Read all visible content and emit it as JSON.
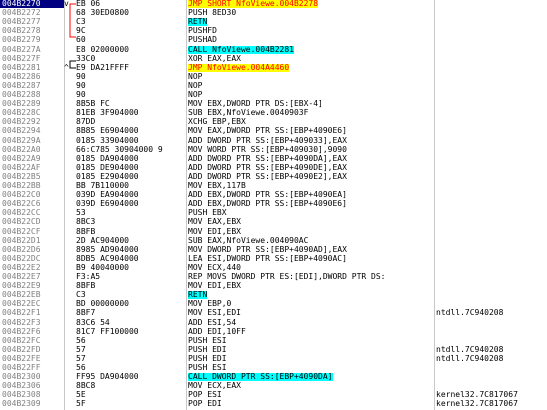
{
  "window_title": "",
  "rows": [
    {
      "addr": "004B2270",
      "marker": "v",
      "hex": "EB 06",
      "dis": "JMP SHORT NfoViewe.004B2278",
      "com": "",
      "hl": "jmp",
      "sel": true
    },
    {
      "addr": "004B2272",
      "marker": "",
      "hex": "68 30ED0800",
      "dis": "PUSH 8ED30",
      "com": "",
      "hl": "",
      "sel": false
    },
    {
      "addr": "004B2277",
      "marker": "",
      "hex": "C3",
      "dis": "RETN",
      "com": "",
      "hl": "call",
      "sel": false
    },
    {
      "addr": "004B2278",
      "marker": "",
      "hex": "9C",
      "dis": "PUSHFD",
      "com": "",
      "hl": "",
      "sel": false
    },
    {
      "addr": "004B2279",
      "marker": "",
      "hex": "60",
      "dis": "PUSHAD",
      "com": "",
      "hl": "",
      "sel": false
    },
    {
      "addr": "004B227A",
      "marker": "",
      "hex": "E8 02000000",
      "dis": "CALL NfoViewe.004B2281",
      "com": "",
      "hl": "call",
      "sel": false
    },
    {
      "addr": "004B227F",
      "marker": "",
      "hex": "33C0",
      "dis": "XOR EAX,EAX",
      "com": "",
      "hl": "",
      "sel": false
    },
    {
      "addr": "004B2281",
      "marker": "^",
      "hex": "E9 DA21FFFF",
      "dis": "JMP NfoViewe.004A4460",
      "com": "",
      "hl": "jmp",
      "sel": false
    },
    {
      "addr": "004B2286",
      "marker": "",
      "hex": "90",
      "dis": "NOP",
      "com": "",
      "hl": "",
      "sel": false
    },
    {
      "addr": "004B2287",
      "marker": "",
      "hex": "90",
      "dis": "NOP",
      "com": "",
      "hl": "",
      "sel": false
    },
    {
      "addr": "004B2288",
      "marker": "",
      "hex": "90",
      "dis": "NOP",
      "com": "",
      "hl": "",
      "sel": false
    },
    {
      "addr": "004B2289",
      "marker": "",
      "hex": "8B5B FC",
      "dis": "MOV EBX,DWORD PTR DS:[EBX-4]",
      "com": "",
      "hl": "",
      "sel": false
    },
    {
      "addr": "004B228C",
      "marker": "",
      "hex": "81EB 3F904000",
      "dis": "SUB EBX,NfoViewe.0040903F",
      "com": "",
      "hl": "",
      "sel": false
    },
    {
      "addr": "004B2292",
      "marker": "",
      "hex": "87DD",
      "dis": "XCHG EBP,EBX",
      "com": "",
      "hl": "",
      "sel": false
    },
    {
      "addr": "004B2294",
      "marker": "",
      "hex": "8B85 E6904000",
      "dis": "MOV EAX,DWORD PTR SS:[EBP+4090E6]",
      "com": "",
      "hl": "",
      "sel": false
    },
    {
      "addr": "004B229A",
      "marker": "",
      "hex": "0185 33904000",
      "dis": "ADD DWORD PTR SS:[EBP+409033],EAX",
      "com": "",
      "hl": "",
      "sel": false
    },
    {
      "addr": "004B22A0",
      "marker": "",
      "hex": "66:C785 30904000 9",
      "dis": "MOV WORD PTR SS:[EBP+409030],9090",
      "com": "",
      "hl": "",
      "sel": false
    },
    {
      "addr": "004B22A9",
      "marker": "",
      "hex": "0185 DA904000",
      "dis": "ADD DWORD PTR SS:[EBP+4090DA],EAX",
      "com": "",
      "hl": "",
      "sel": false
    },
    {
      "addr": "004B22AF",
      "marker": "",
      "hex": "0185 DE904000",
      "dis": "ADD DWORD PTR SS:[EBP+4090DE],EAX",
      "com": "",
      "hl": "",
      "sel": false
    },
    {
      "addr": "004B22B5",
      "marker": "",
      "hex": "0185 E2904000",
      "dis": "ADD DWORD PTR SS:[EBP+4090E2],EAX",
      "com": "",
      "hl": "",
      "sel": false
    },
    {
      "addr": "004B22BB",
      "marker": "",
      "hex": "BB 7B110000",
      "dis": "MOV EBX,117B",
      "com": "",
      "hl": "",
      "sel": false
    },
    {
      "addr": "004B22C0",
      "marker": "",
      "hex": "039D EA904000",
      "dis": "ADD EBX,DWORD PTR SS:[EBP+4090EA]",
      "com": "",
      "hl": "",
      "sel": false
    },
    {
      "addr": "004B22C6",
      "marker": "",
      "hex": "039D E6904000",
      "dis": "ADD EBX,DWORD PTR SS:[EBP+4090E6]",
      "com": "",
      "hl": "",
      "sel": false
    },
    {
      "addr": "004B22CC",
      "marker": "",
      "hex": "53",
      "dis": "PUSH EBX",
      "com": "",
      "hl": "",
      "sel": false
    },
    {
      "addr": "004B22CD",
      "marker": "",
      "hex": "8BC3",
      "dis": "MOV EAX,EBX",
      "com": "",
      "hl": "",
      "sel": false
    },
    {
      "addr": "004B22CF",
      "marker": "",
      "hex": "8BFB",
      "dis": "MOV EDI,EBX",
      "com": "",
      "hl": "",
      "sel": false
    },
    {
      "addr": "004B22D1",
      "marker": "",
      "hex": "2D AC904000",
      "dis": "SUB EAX,NfoViewe.004090AC",
      "com": "",
      "hl": "",
      "sel": false
    },
    {
      "addr": "004B22D6",
      "marker": "",
      "hex": "8985 AD904000",
      "dis": "MOV DWORD PTR SS:[EBP+4090AD],EAX",
      "com": "",
      "hl": "",
      "sel": false
    },
    {
      "addr": "004B22DC",
      "marker": "",
      "hex": "8DB5 AC904000",
      "dis": "LEA ESI,DWORD PTR SS:[EBP+4090AC]",
      "com": "",
      "hl": "",
      "sel": false
    },
    {
      "addr": "004B22E2",
      "marker": "",
      "hex": "B9 40040000",
      "dis": "MOV ECX,440",
      "com": "",
      "hl": "",
      "sel": false
    },
    {
      "addr": "004B22E7",
      "marker": "",
      "hex": "F3:A5",
      "dis": "REP MOVS DWORD PTR ES:[EDI],DWORD PTR DS:",
      "com": "",
      "hl": "",
      "sel": false
    },
    {
      "addr": "004B22E9",
      "marker": "",
      "hex": "8BFB",
      "dis": "MOV EDI,EBX",
      "com": "",
      "hl": "",
      "sel": false
    },
    {
      "addr": "004B22EB",
      "marker": "",
      "hex": "C3",
      "dis": "RETN",
      "com": "",
      "hl": "call",
      "sel": false
    },
    {
      "addr": "004B22EC",
      "marker": "",
      "hex": "BD 00000000",
      "dis": "MOV EBP,0",
      "com": "",
      "hl": "",
      "sel": false
    },
    {
      "addr": "004B22F1",
      "marker": "",
      "hex": "8BF7",
      "dis": "MOV ESI,EDI",
      "com": "ntdll.7C940208",
      "hl": "",
      "sel": false
    },
    {
      "addr": "004B22F3",
      "marker": "",
      "hex": "83C6 54",
      "dis": "ADD ESI,54",
      "com": "",
      "hl": "",
      "sel": false
    },
    {
      "addr": "004B22F6",
      "marker": "",
      "hex": "81C7 FF100000",
      "dis": "ADD EDI,10FF",
      "com": "",
      "hl": "",
      "sel": false
    },
    {
      "addr": "004B22FC",
      "marker": "",
      "hex": "56",
      "dis": "PUSH ESI",
      "com": "",
      "hl": "",
      "sel": false
    },
    {
      "addr": "004B22FD",
      "marker": "",
      "hex": "57",
      "dis": "PUSH EDI",
      "com": "ntdll.7C940208",
      "hl": "",
      "sel": false
    },
    {
      "addr": "004B22FE",
      "marker": "",
      "hex": "57",
      "dis": "PUSH EDI",
      "com": "ntdll.7C940208",
      "hl": "",
      "sel": false
    },
    {
      "addr": "004B22FF",
      "marker": "",
      "hex": "56",
      "dis": "PUSH ESI",
      "com": "",
      "hl": "",
      "sel": false
    },
    {
      "addr": "004B2300",
      "marker": "",
      "hex": "FF95 DA904000",
      "dis": "CALL DWORD PTR SS:[EBP+4090DA]",
      "com": "",
      "hl": "call",
      "sel": false
    },
    {
      "addr": "004B2306",
      "marker": "",
      "hex": "8BC8",
      "dis": "MOV ECX,EAX",
      "com": "",
      "hl": "",
      "sel": false
    },
    {
      "addr": "004B2308",
      "marker": "",
      "hex": "5E",
      "dis": "POP ESI",
      "com": "kernel32.7C817067",
      "hl": "",
      "sel": false
    },
    {
      "addr": "004B2309",
      "marker": "",
      "hex": "5F",
      "dis": "POP EDI",
      "com": "kernel32.7C817067",
      "hl": "",
      "sel": false
    }
  ],
  "colors": {
    "selection": "#000080",
    "jmp_bg": "#ffff00",
    "jmp_fg": "#ff0000",
    "call_bg": "#00ffff"
  }
}
